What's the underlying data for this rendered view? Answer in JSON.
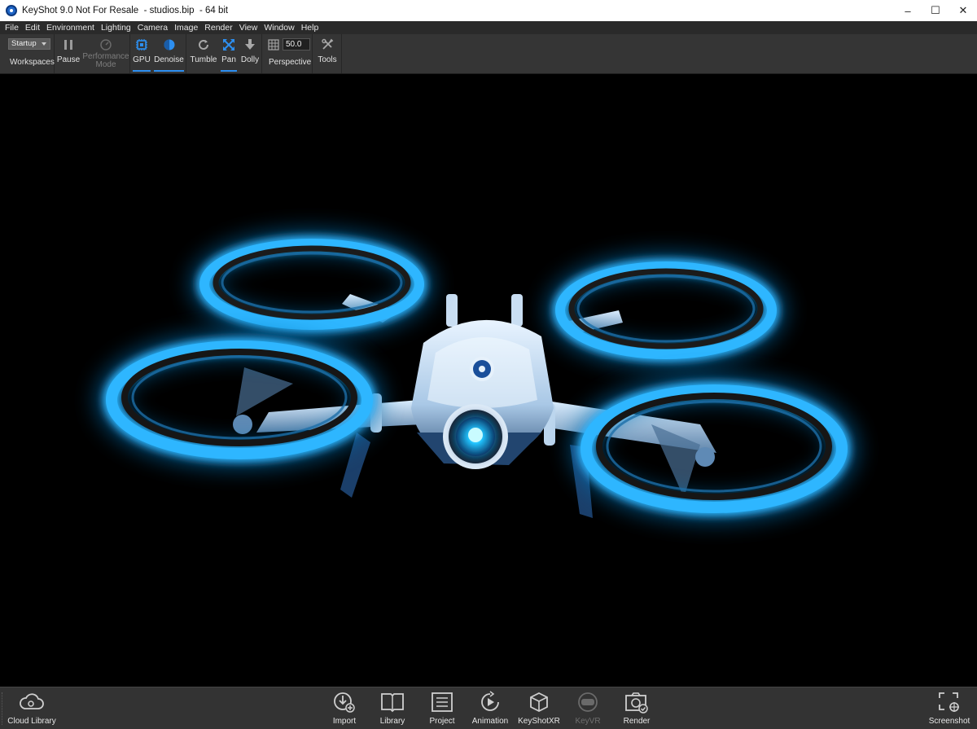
{
  "window": {
    "title": "KeyShot 9.0 Not For Resale  - studios.bip  - 64 bit",
    "minimize": "–",
    "maximize": "☐",
    "close": "✕"
  },
  "menu": [
    "File",
    "Edit",
    "Environment",
    "Lighting",
    "Camera",
    "Image",
    "Render",
    "View",
    "Window",
    "Help"
  ],
  "toolbar": {
    "workspace_value": "Startup",
    "workspaces_label": "Workspaces",
    "pause_label": "Pause",
    "performance_label_1": "Performance",
    "performance_label_2": "Mode",
    "gpu_label": "GPU",
    "denoise_label": "Denoise",
    "tumble_label": "Tumble",
    "pan_label": "Pan",
    "dolly_label": "Dolly",
    "fov_value": "50.0",
    "perspective_label": "Perspective",
    "tools_label": "Tools",
    "accent_color": "#2d8ff0"
  },
  "bottom": {
    "cloud_library": "Cloud Library",
    "import": "Import",
    "library": "Library",
    "project": "Project",
    "animation": "Animation",
    "keyshotxr": "KeyShotXR",
    "keyvr": "KeyVR",
    "render": "Render",
    "screenshot": "Screenshot"
  },
  "viewport": {
    "subject": "drone-model",
    "glow_color": "#2fb6ff"
  }
}
